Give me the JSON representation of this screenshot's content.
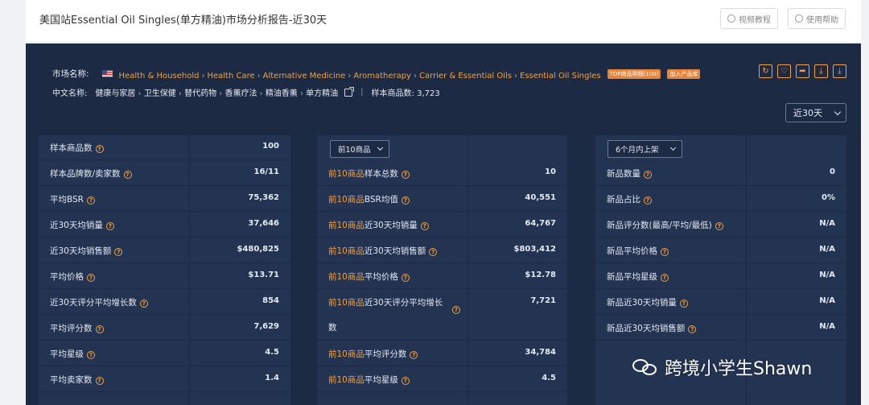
{
  "header": {
    "title": "美国站Essential Oil Singles(单方精油)市场分析报告-近30天",
    "buttons": [
      {
        "label": "视频教程",
        "icon": "play-icon"
      },
      {
        "label": "使用帮助",
        "icon": "help-icon"
      }
    ]
  },
  "market": {
    "key": "市场名称:",
    "flag": "us-flag-icon",
    "breadcrumb": [
      "Health & Household",
      "Health Care",
      "Alternative Medicine",
      "Aromatherapy",
      "Carrier & Essential Oils",
      "Essential Oil Singles"
    ],
    "tags": [
      "TOP商品明细(100)",
      "加入产品库"
    ],
    "cn_key": "中文名称:",
    "cn_path": [
      "健康与家居",
      "卫生保健",
      "替代药物",
      "香薰疗法",
      "精油香薰",
      "单方精油"
    ],
    "sample_count_text": "样本商品数: 3,723",
    "range_select": "近30天"
  },
  "tools": [
    "refresh-icon",
    "heart-icon",
    "share-icon",
    "download-icon",
    "download-all-icon"
  ],
  "colors": {
    "panel": "#1c2a44",
    "cell": "#233352",
    "accent": "#f0a245"
  },
  "col1": {
    "rows": [
      {
        "k": "样本商品数",
        "v": "100"
      },
      {
        "k": "样本品牌数/卖家数",
        "v": "16/11"
      },
      {
        "k": "平均BSR",
        "v": "75,362"
      },
      {
        "k": "近30天均销量",
        "v": "37,646"
      },
      {
        "k": "近30天均销售额",
        "v": "$480,825"
      },
      {
        "k": "平均价格",
        "v": "$13.71"
      },
      {
        "k": "近30天评分平均增长数",
        "v": "854"
      },
      {
        "k": "平均评分数",
        "v": "7,629"
      },
      {
        "k": "平均星级",
        "v": "4.5"
      },
      {
        "k": "平均卖家数",
        "v": "1.4"
      }
    ]
  },
  "col2": {
    "dropdown": "前10商品",
    "prefix": "前10商品",
    "rows": [
      {
        "k": "样本总数",
        "v": "10"
      },
      {
        "k": "BSR均值",
        "v": "40,551"
      },
      {
        "k": "近30天均销量",
        "v": "64,767"
      },
      {
        "k": "近30天均销售额",
        "v": "$803,412"
      },
      {
        "k": "平均价格",
        "v": "$12.78"
      },
      {
        "k1": "近30天评分平均增长",
        "k2": "数",
        "v": "7,721"
      },
      {
        "k": "平均评分数",
        "v": "34,784"
      },
      {
        "k": "平均星级",
        "v": "4.5"
      }
    ]
  },
  "col3": {
    "dropdown": "6个月内上架",
    "rows": [
      {
        "k": "新品数量",
        "v": "0"
      },
      {
        "k": "新品占比",
        "v": "0%"
      },
      {
        "k": "新品评分数(最高/平均/最低)",
        "v": "N/A"
      },
      {
        "k": "新品平均价格",
        "v": "N/A"
      },
      {
        "k": "新品平均星级",
        "v": "N/A"
      },
      {
        "k": "新品近30天均销量",
        "v": "N/A"
      },
      {
        "k": "新品近30天均销售额",
        "v": "N/A"
      }
    ]
  },
  "watermark": {
    "icon": "wechat-icon",
    "text": "跨境小学生Shawn"
  }
}
